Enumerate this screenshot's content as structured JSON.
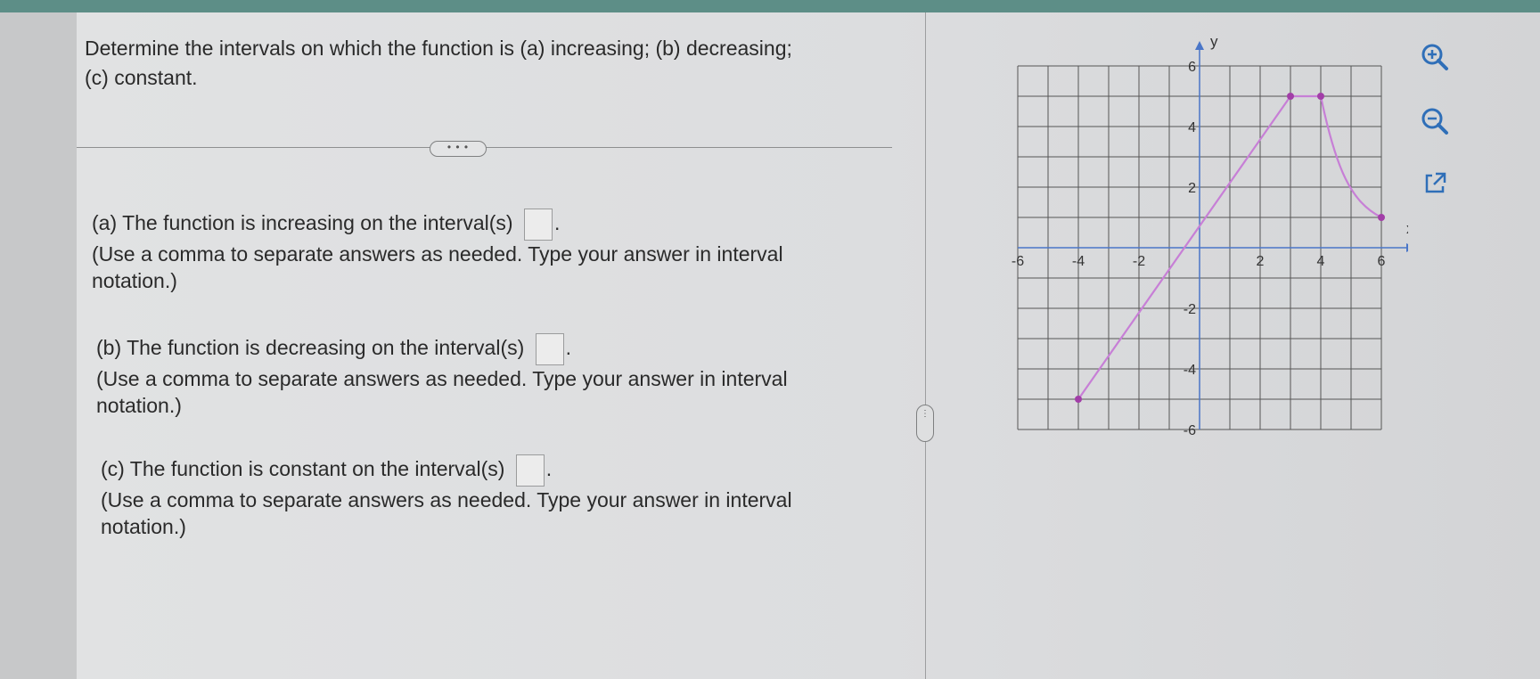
{
  "question": {
    "prompt": "Determine the intervals on which the function is (a) increasing; (b) decreasing; (c) constant."
  },
  "expand_button_label": "• • •",
  "parts": [
    {
      "label": "(a) The function is increasing on the interval(s)",
      "answer": "",
      "hint": "(Use a comma to separate answers as needed. Type your answer in interval notation.)"
    },
    {
      "label": "(b) The function is decreasing on the interval(s)",
      "answer": "",
      "hint": "(Use a comma to separate answers as needed. Type your answer in interval notation.)"
    },
    {
      "label": "(c) The function is constant on the interval(s)",
      "answer": "",
      "hint": "(Use a comma to separate answers as needed. Type your answer in interval notation.)"
    }
  ],
  "splitter_label": "⋮",
  "tools": {
    "zoom_in": "zoom-in-icon",
    "zoom_out": "zoom-out-icon",
    "popout": "external-link-icon"
  },
  "chart_data": {
    "type": "line",
    "xlabel": "x",
    "ylabel": "y",
    "xlim": [
      -6,
      7
    ],
    "ylim": [
      -6,
      6
    ],
    "grid": true,
    "x_ticks": [
      -6,
      -4,
      -2,
      2,
      4,
      6
    ],
    "y_ticks": [
      6,
      4,
      2,
      -2,
      -4,
      -6
    ],
    "tick_labels_x": [
      "-6",
      "-4",
      "-2",
      "2",
      "4",
      "6"
    ],
    "tick_labels_y": [
      "6",
      "4",
      "2",
      "-2",
      "-4",
      "-6"
    ],
    "series": [
      {
        "segments": [
          {
            "kind": "line",
            "points": [
              [
                -4,
                -5
              ],
              [
                3,
                5
              ]
            ]
          },
          {
            "kind": "line",
            "points": [
              [
                3,
                5
              ],
              [
                4,
                5
              ]
            ]
          },
          {
            "kind": "curve",
            "points": [
              [
                4,
                5
              ],
              [
                4.5,
                2.6
              ],
              [
                5,
                1.5
              ],
              [
                6,
                1
              ]
            ]
          }
        ],
        "dots": [
          [
            -4,
            -5
          ],
          [
            3,
            5
          ],
          [
            4,
            5
          ],
          [
            6,
            1
          ]
        ]
      }
    ],
    "colors": {
      "curve": "#c77fd6",
      "dot": "#a23ea8",
      "grid": "#555555",
      "axis": "#4a76c8"
    }
  }
}
